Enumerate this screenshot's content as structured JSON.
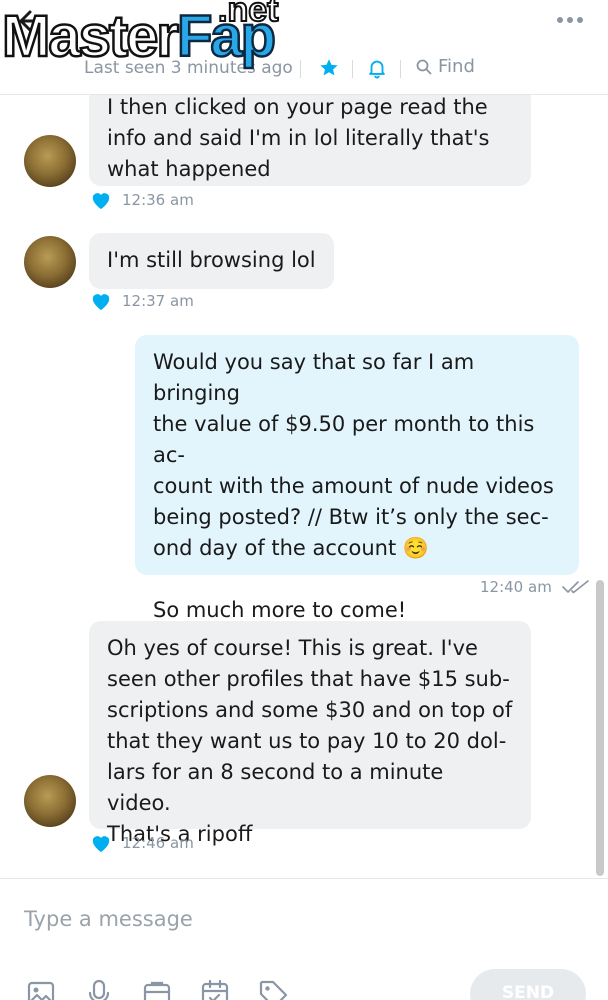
{
  "header": {
    "contact_name": "",
    "last_seen": "Last seen 3 minutes ago",
    "find_label": "Find"
  },
  "watermark": {
    "part1": "Master",
    "part2": "Fap",
    "part3": ".net"
  },
  "messages": [
    {
      "direction": "incoming",
      "text": "I then clicked on your page read the\ninfo and said I'm in lol literally that's\nwhat happened",
      "time": "12:36 am",
      "liked": true
    },
    {
      "direction": "incoming",
      "text": "I'm still browsing lol",
      "time": "12:37 am",
      "liked": true
    },
    {
      "direction": "outgoing",
      "text": "Would you say that so far I am bringing\nthe value of $9.50 per month to this ac-\ncount with the amount of nude videos\nbeing posted? // Btw it’s only the sec-\nond day of the account ☺️\n\nSo much more to come!",
      "time": "12:40 am",
      "read": true
    },
    {
      "direction": "incoming",
      "text": "Oh yes of course! This is great. I've\nseen other profiles that have $15 sub-\nscriptions and some $30 and on top of\nthat they want us to pay 10 to 20 dol-\nlars for an 8 second to a minute video.\nThat's a ripoff",
      "time": "12:46 am",
      "liked": true
    }
  ],
  "composer": {
    "placeholder": "Type a message",
    "send_label": "SEND"
  },
  "icons": {
    "back": "back-arrow-icon",
    "star": "star-icon",
    "bell": "bell-icon",
    "search": "search-icon",
    "more": "more-icon",
    "heart": "heart-icon",
    "read": "double-check-icon",
    "media": "image-icon",
    "voice": "microphone-icon",
    "vault": "vault-icon",
    "schedule": "calendar-icon",
    "price": "price-tag-icon"
  },
  "colors": {
    "accent": "#00aff0",
    "incoming_bubble": "#eef0f2",
    "outgoing_bubble": "#e2f4fc",
    "muted_text": "#8a96a3"
  }
}
